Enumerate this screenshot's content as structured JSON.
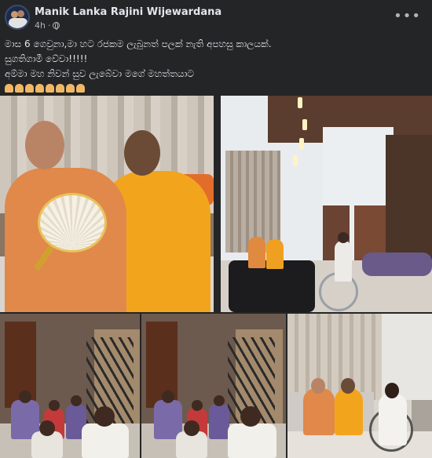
{
  "post": {
    "author": "Manik Lanka Rajini Wijewardana",
    "time": "4h",
    "visibility_icon": "globe-icon",
    "more_icon": "more-icon",
    "more_label": "•••"
  },
  "text": {
    "line1": "මාස 6 ගෙවුනා,මා හට රජකම ලැබුනත් පලක් නැති අපහසු කාලයක්.",
    "line2": "සුගතිගාමී වේවා!!!!!",
    "line3": "අම්මා මහ නිවන් සුව ලැබේවා මගේ මහත්තයාට",
    "emoji_icon": "folded-hands-icon",
    "emoji_count": 8
  },
  "photos": [
    {
      "id": 1,
      "desc": "photo-monks-sofa"
    },
    {
      "id": 2,
      "desc": "photo-room-gathering"
    },
    {
      "id": 3,
      "desc": "photo-staircase-group-1"
    },
    {
      "id": 4,
      "desc": "photo-staircase-group-2"
    },
    {
      "id": 5,
      "desc": "photo-monks-wheelchair"
    }
  ],
  "colors": {
    "background": "#242526",
    "text": "#e4e6eb",
    "secondary_text": "#b0b3b8"
  }
}
